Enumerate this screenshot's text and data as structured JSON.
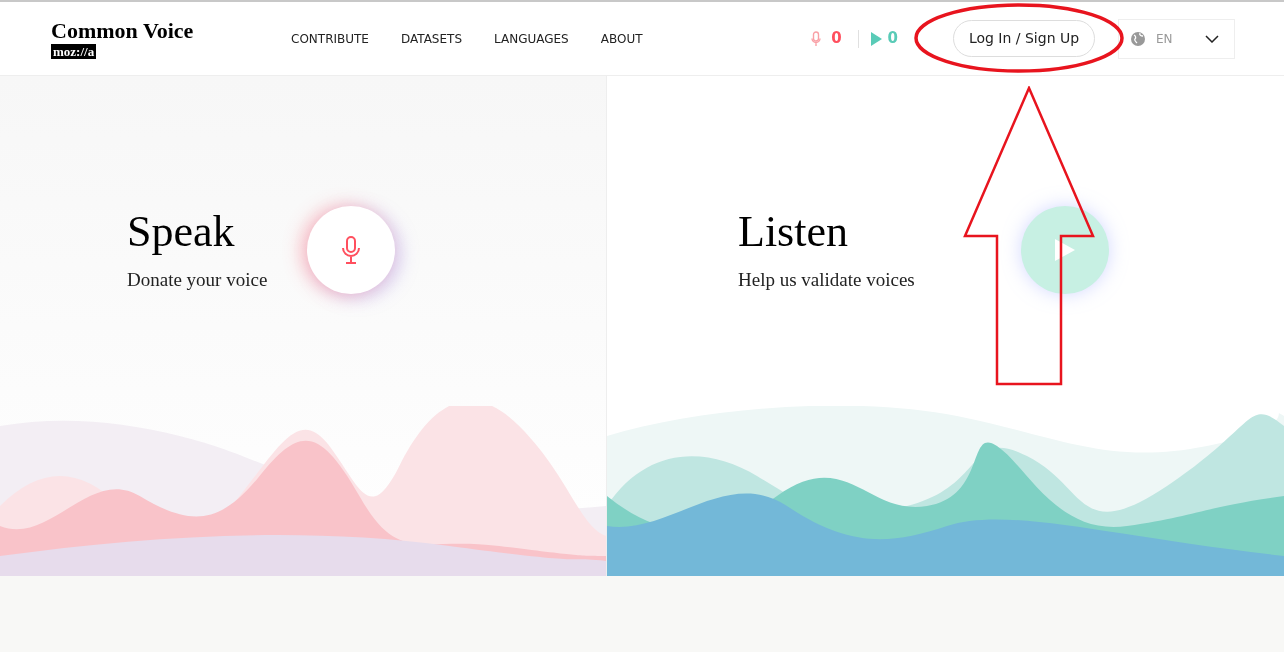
{
  "header": {
    "logo": {
      "title": "Common Voice",
      "badge": "moz://a"
    },
    "nav": [
      {
        "label": "CONTRIBUTE"
      },
      {
        "label": "DATASETS"
      },
      {
        "label": "LANGUAGES"
      },
      {
        "label": "ABOUT"
      }
    ],
    "stats": {
      "recordings": "0",
      "validations": "0"
    },
    "login_button": "Log In / Sign Up",
    "language": "EN"
  },
  "panels": [
    {
      "kind": "speak",
      "title": "Speak",
      "subtitle": "Donate your voice"
    },
    {
      "kind": "listen",
      "title": "Listen",
      "subtitle": "Help us validate voices"
    }
  ]
}
